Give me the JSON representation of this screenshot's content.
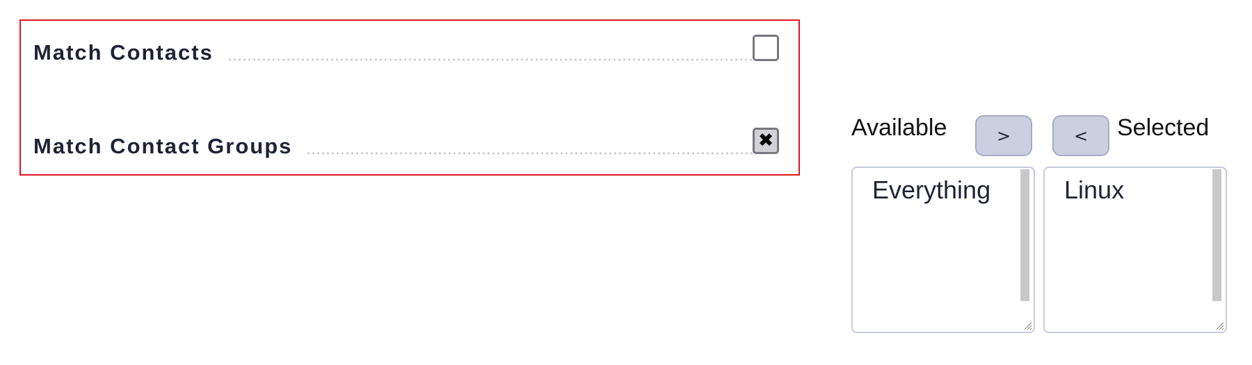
{
  "match_panel": {
    "rows": [
      {
        "label": "Match Contacts",
        "checked": false,
        "check_glyph": ""
      },
      {
        "label": "Match Contact Groups",
        "checked": true,
        "check_glyph": "✖"
      }
    ],
    "border_color": "#e0141e"
  },
  "dual_list": {
    "available_label": "Available",
    "selected_label": "Selected",
    "add_button": ">",
    "remove_button": "<",
    "available_options": [
      "Everything"
    ],
    "selected_options": [
      "Linux"
    ],
    "button_color": "#cccfdf"
  }
}
